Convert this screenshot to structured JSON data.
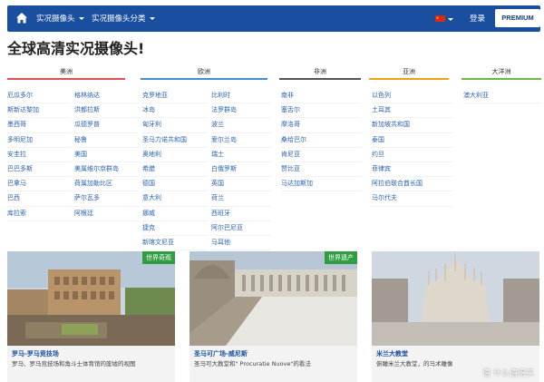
{
  "nav": {
    "items": [
      "实况摄像头",
      "实况摄像头分类"
    ],
    "login": "登录",
    "premium": "PREMIUM"
  },
  "title": "全球高清实况摄像头!",
  "regions": [
    {
      "name": "美洲",
      "color": "#d9534f"
    },
    {
      "name": "欧洲",
      "color": "#3e8fd6"
    },
    {
      "name": "非洲",
      "color": "#555555"
    },
    {
      "name": "亚洲",
      "color": "#e8a317"
    },
    {
      "name": "大洋洲",
      "color": "#6cb93f"
    }
  ],
  "americas_col1": [
    "厄瓜多尔",
    "斯新达黎加",
    "墨西哥",
    "多明尼加",
    "安圭拉",
    "巴巴多斯",
    "巴拿马",
    "巴西",
    "库拉索"
  ],
  "americas_col2": [
    "格林纳达",
    "洪都拉斯",
    "瓜德罗普",
    "秘鲁",
    "美国",
    "美属维尔京群岛",
    "荷属加勒比区",
    "萨尔瓦多",
    "阿根廷"
  ],
  "europe_col1": [
    "克罗地亚",
    "冰岛",
    "匈牙利",
    "圣马力诺共和国",
    "奥地利",
    "希腊",
    "德国",
    "意大利",
    "挪威",
    "捷克",
    "新喀文尼亚"
  ],
  "europe_col2": [
    "比利时",
    "法罗群岛",
    "波兰",
    "爱尔兰岛",
    "瑞士",
    "白俄罗斯",
    "英国",
    "荷兰",
    "西班牙",
    "阿尔巴尼亚",
    "马耳他"
  ],
  "africa": [
    "南非",
    "塞舌尔",
    "摩洛哥",
    "桑给巴尔",
    "肯尼亚",
    "赞比亚",
    "马达加斯加"
  ],
  "asia": [
    "以色列",
    "土耳其",
    "新加坡共和国",
    "泰国",
    "约旦",
    "菲律宾",
    "阿拉伯联合酋长国",
    "马尔代夫"
  ],
  "oceania": [
    "澳大利亚"
  ],
  "cards": [
    {
      "title": "罗马-罗马竞技场",
      "desc": "罗马、罗马竞技场和角斗士体育馆的废墟的视图",
      "badge": "世界奇观"
    },
    {
      "title": "圣马可广场-威尼斯",
      "desc": "圣马可大教堂和\" Procuratie Nuove\"的看法",
      "badge": "世界遗产"
    },
    {
      "title": "米兰大教堂",
      "desc": "俯瞰米兰大教堂，的马术雕像",
      "badge": ""
    }
  ],
  "watermark": "值 什么值得买",
  "icons": {
    "home": "home-icon"
  }
}
